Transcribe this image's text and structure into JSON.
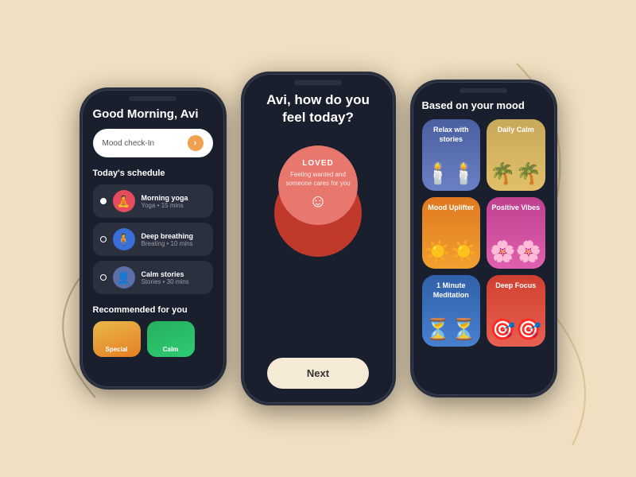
{
  "background": "#f0dfc0",
  "phone1": {
    "greeting": "Good Morning, Avi",
    "moodCheckin": {
      "label": "Mood check-In",
      "arrowIcon": "›"
    },
    "todaysSchedule": {
      "title": "Today's schedule",
      "items": [
        {
          "name": "Morning yoga",
          "meta": "Yoga • 15 mins",
          "emoji": "🧘",
          "type": "yoga",
          "dotFilled": true
        },
        {
          "name": "Deep breathing",
          "meta": "Breating • 10 mins",
          "emoji": "🧍",
          "type": "breathing",
          "dotFilled": false
        },
        {
          "name": "Calm stories",
          "meta": "Stories • 30 mins",
          "emoji": "👤",
          "type": "stories",
          "dotFilled": false
        }
      ]
    },
    "recommended": {
      "title": "Recommended for you",
      "items": [
        {
          "label": "Special",
          "type": "special"
        },
        {
          "label": "Calm",
          "type": "calm"
        }
      ]
    }
  },
  "phone2": {
    "question": "Avi, how do you feel today?",
    "moodLabel": "LOVED",
    "moodDescription": "Feeling wanted and someone cares for you",
    "smileIcon": "☺",
    "nextButton": "Next"
  },
  "phone3": {
    "sectionTitle": "Based on your mood",
    "cards": [
      {
        "label": "Relax with stories",
        "type": "relax",
        "icon": "🕯️"
      },
      {
        "label": "Daily Calm",
        "type": "daily",
        "icon": "🌴"
      },
      {
        "label": "Mood Uplifter",
        "type": "mood",
        "icon": "☀️"
      },
      {
        "label": "Positive Vibes",
        "type": "positive",
        "icon": "🌸"
      },
      {
        "label": "1 Minute Meditation",
        "type": "minute",
        "icon": "⏳"
      },
      {
        "label": "Deep Focus",
        "type": "focus",
        "icon": "🎯"
      }
    ]
  }
}
